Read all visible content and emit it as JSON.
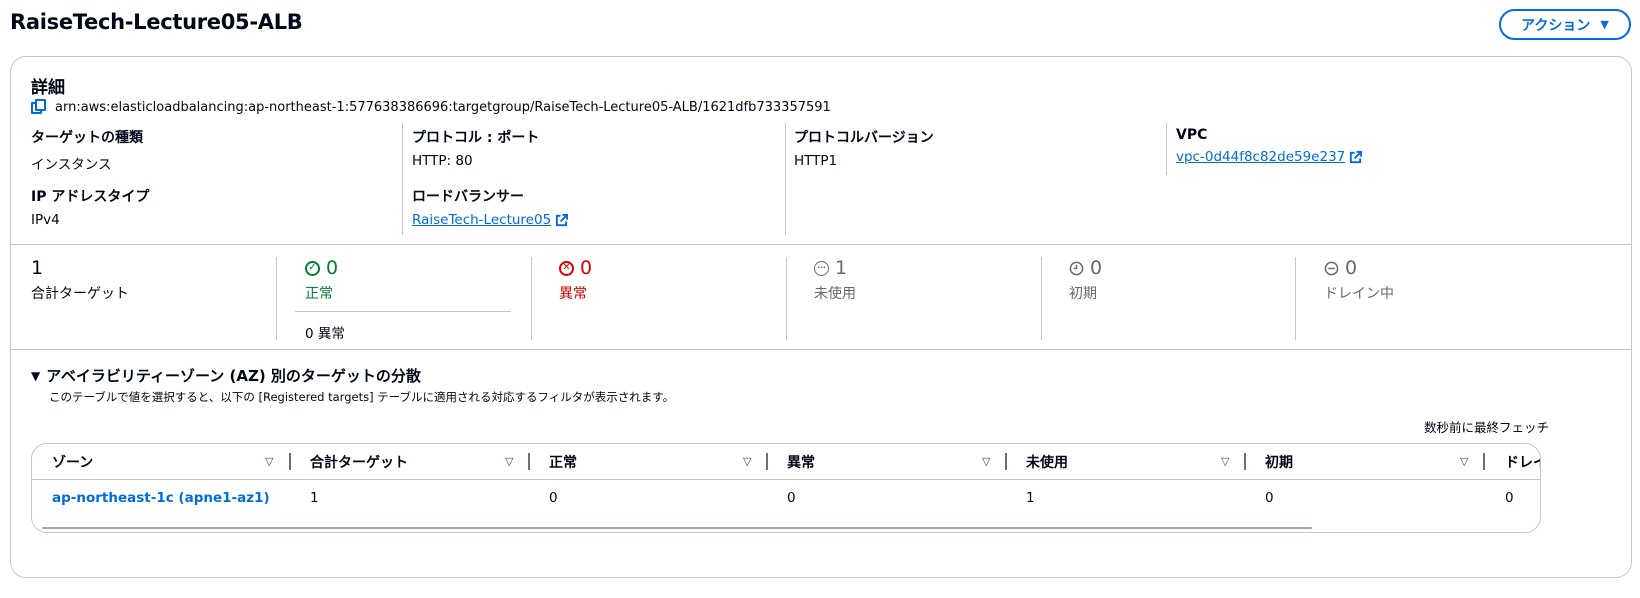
{
  "header": {
    "title": "RaiseTech-Lecture05-ALB",
    "actions_label": "アクション",
    "actions_caret": "▼"
  },
  "details": {
    "title": "詳細",
    "arn": "arn:aws:elasticloadbalancing:ap-northeast-1:577638386696:targetgroup/RaiseTech-Lecture05-ALB/1621dfb733357591",
    "target_type_label": "ターゲットの種類",
    "target_type_value": "インスタンス",
    "ip_type_label": "IP アドレスタイプ",
    "ip_type_value": "IPv4",
    "protocol_port_label": "プロトコル : ポート",
    "protocol_port_value": "HTTP: 80",
    "load_balancer_label": "ロードバランサー",
    "load_balancer_value": "RaiseTech-Lecture05",
    "protocol_version_label": "プロトコルバージョン",
    "protocol_version_value": "HTTP1",
    "vpc_label": "VPC",
    "vpc_value": "vpc-0d44f8c82de59e237"
  },
  "stats": {
    "total": {
      "value": "1",
      "label": "合計ターゲット"
    },
    "healthy": {
      "value": "0",
      "label": "正常",
      "sub": "0 異常"
    },
    "unhealthy": {
      "value": "0",
      "label": "異常"
    },
    "unused": {
      "value": "1",
      "label": "未使用"
    },
    "initial": {
      "value": "0",
      "label": "初期"
    },
    "draining": {
      "value": "0",
      "label": "ドレイン中"
    }
  },
  "az": {
    "toggle": "▼",
    "title": "アベイラビリティーゾーン (AZ) 別のターゲットの分散",
    "description": "このテーブルで値を選択すると、以下の [Registered targets] テーブルに適用される対応するフィルタが表示されます。",
    "fetched": "数秒前に最終フェッチ",
    "columns": [
      "ゾーン",
      "合計ターゲット",
      "正常",
      "異常",
      "未使用",
      "初期",
      "ドレイ"
    ],
    "rows": [
      {
        "zone": "ap-northeast-1c (apne1-az1)",
        "total": "1",
        "healthy": "0",
        "unhealthy": "0",
        "unused": "1",
        "initial": "0",
        "draining": "0"
      }
    ]
  },
  "colors": {
    "accent": "#006ce0",
    "success": "#00802f",
    "error": "#db0000",
    "muted": "#656871",
    "border": "#c6c6cd"
  },
  "icons": {
    "copy": "copy-icon",
    "external": "external-link-icon",
    "success": "status-positive-icon",
    "error": "status-negative-icon",
    "unused": "status-stopped-icon",
    "initial": "status-pending-icon",
    "draining": "status-draining-icon",
    "sort": "sort-icon"
  }
}
